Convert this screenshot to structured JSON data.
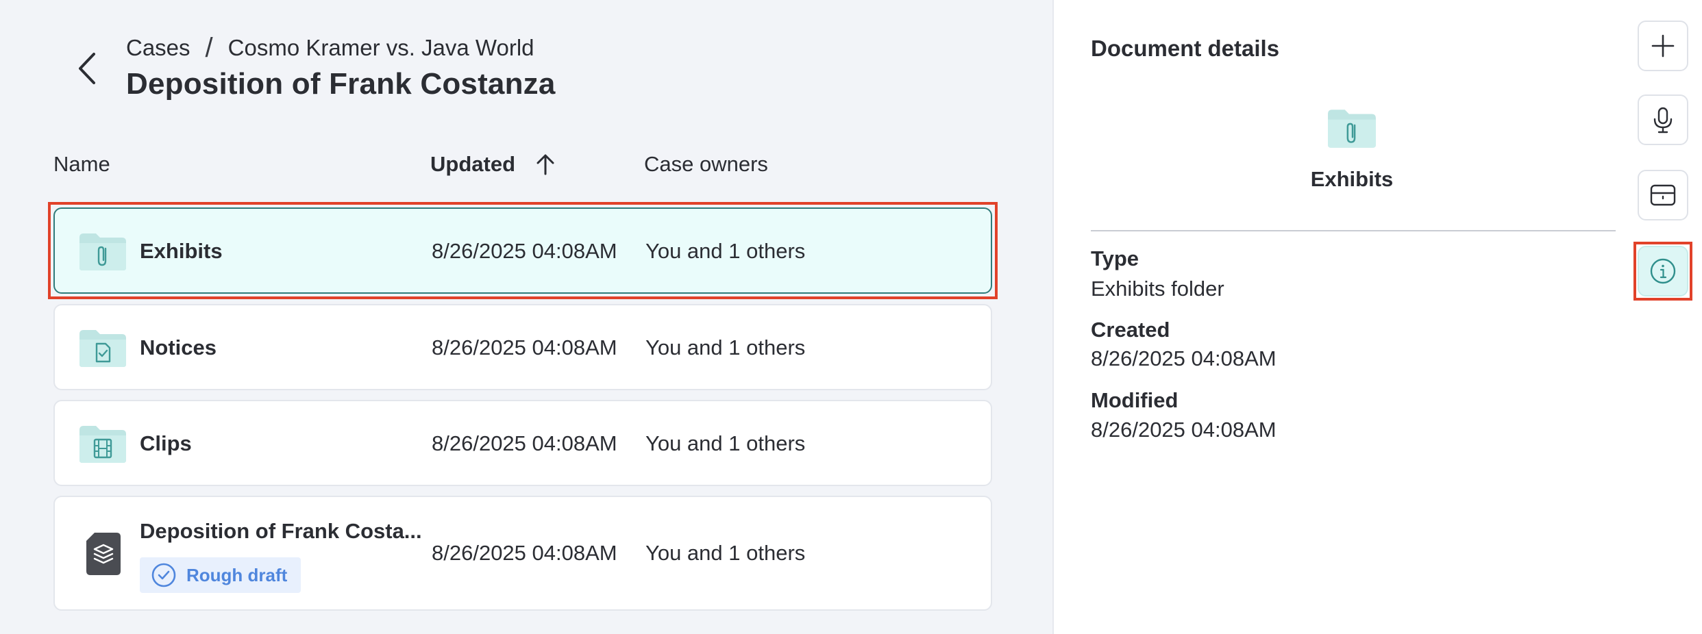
{
  "breadcrumb": {
    "root": "Cases",
    "separator": "/",
    "case": "Cosmo Kramer vs. Java World"
  },
  "page_title": "Deposition of Frank Costanza",
  "table": {
    "headers": {
      "name": "Name",
      "updated": "Updated",
      "owners": "Case owners"
    },
    "rows": [
      {
        "name": "Exhibits",
        "updated": "8/26/2025 04:08AM",
        "owners": "You and 1 others",
        "icon": "folder-paperclip-icon"
      },
      {
        "name": "Notices",
        "updated": "8/26/2025 04:08AM",
        "owners": "You and 1 others",
        "icon": "folder-document-check-icon"
      },
      {
        "name": "Clips",
        "updated": "8/26/2025 04:08AM",
        "owners": "You and 1 others",
        "icon": "folder-film-icon"
      },
      {
        "name": "Deposition of Frank Costa...",
        "updated": "8/26/2025 04:08AM",
        "owners": "You and 1 others",
        "icon": "layers-document-icon",
        "badge": "Rough draft"
      }
    ]
  },
  "details": {
    "title": "Document details",
    "name": "Exhibits",
    "type_label": "Type",
    "type_value": "Exhibits folder",
    "created_label": "Created",
    "created_value": "8/26/2025 04:08AM",
    "modified_label": "Modified",
    "modified_value": "8/26/2025 04:08AM"
  },
  "rail": [
    "plus-icon",
    "microphone-icon",
    "card-icon",
    "info-icon"
  ],
  "colors": {
    "accent_teal": "#2f7b7a",
    "folder_teal": "#bfe5e3",
    "selected_bg": "#eafcfb",
    "highlight_red": "#e1422a",
    "badge_blue": "#4f86dd"
  }
}
